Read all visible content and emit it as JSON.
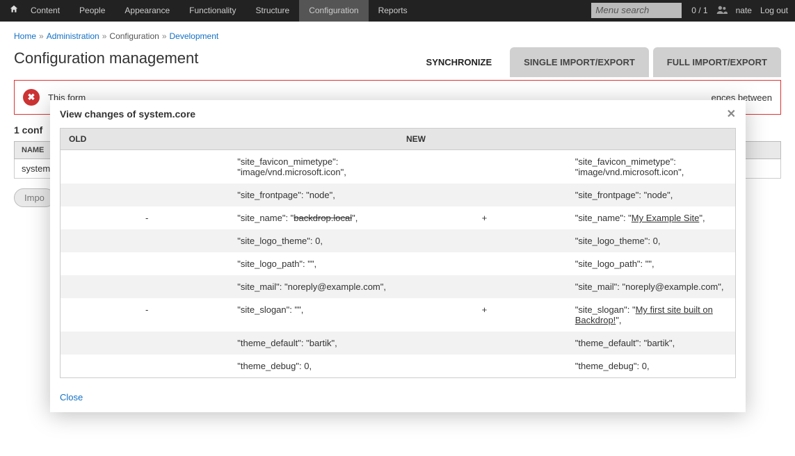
{
  "adminbar": {
    "nav": [
      "Content",
      "People",
      "Appearance",
      "Functionality",
      "Structure",
      "Configuration",
      "Reports"
    ],
    "active_index": 5,
    "search_placeholder": "Menu search",
    "user_count": "0 / 1",
    "user_name": "nate",
    "logout": "Log out"
  },
  "breadcrumb": [
    {
      "label": "Home",
      "link": true
    },
    {
      "label": "Administration",
      "link": true
    },
    {
      "label": "Configuration",
      "link": false
    },
    {
      "label": "Development",
      "link": true
    }
  ],
  "page_title": "Configuration management",
  "tabs": [
    {
      "label": "SYNCHRONIZE",
      "active": true
    },
    {
      "label": "SINGLE IMPORT/EXPORT",
      "active": false
    },
    {
      "label": "FULL IMPORT/EXPORT",
      "active": false
    }
  ],
  "error_text_prefix": "This form ",
  "error_text_suffix": "ences between",
  "count_heading": "1 conf",
  "table_header": "NAME",
  "table_cell": "system",
  "import_label": "Impo",
  "modal": {
    "title": "View changes of system.core",
    "close_label": "Close",
    "columns": {
      "old": "OLD",
      "new": "NEW"
    },
    "rows": [
      {
        "sign": "",
        "old": "\"site_favicon_mimetype\": \"image/vnd.microsoft.icon\",",
        "new": "\"site_favicon_mimetype\": \"image/vnd.microsoft.icon\","
      },
      {
        "sign": "",
        "old": "\"site_frontpage\": \"node\",",
        "new": "\"site_frontpage\": \"node\","
      },
      {
        "sign": "diff",
        "old_pre": "\"site_name\": \"",
        "old_del": "backdrop.local",
        "old_post": "\",",
        "new_pre": "\"site_name\": \"",
        "new_ins": "My Example Site",
        "new_post": "\","
      },
      {
        "sign": "",
        "old": "\"site_logo_theme\": 0,",
        "new": "\"site_logo_theme\": 0,"
      },
      {
        "sign": "",
        "old": "\"site_logo_path\": \"\",",
        "new": "\"site_logo_path\": \"\","
      },
      {
        "sign": "",
        "old": "\"site_mail\": \"noreply@example.com\",",
        "new": "\"site_mail\": \"noreply@example.com\","
      },
      {
        "sign": "diff",
        "old_pre": "\"site_slogan\": \"\",",
        "old_del": "",
        "old_post": "",
        "new_pre": "\"site_slogan\": \"",
        "new_ins": "My first site built on Backdrop!",
        "new_post": "\","
      },
      {
        "sign": "",
        "old": "\"theme_default\": \"bartik\",",
        "new": "\"theme_default\": \"bartik\","
      },
      {
        "sign": "",
        "old": "\"theme_debug\": 0,",
        "new": "\"theme_debug\": 0,"
      }
    ]
  }
}
